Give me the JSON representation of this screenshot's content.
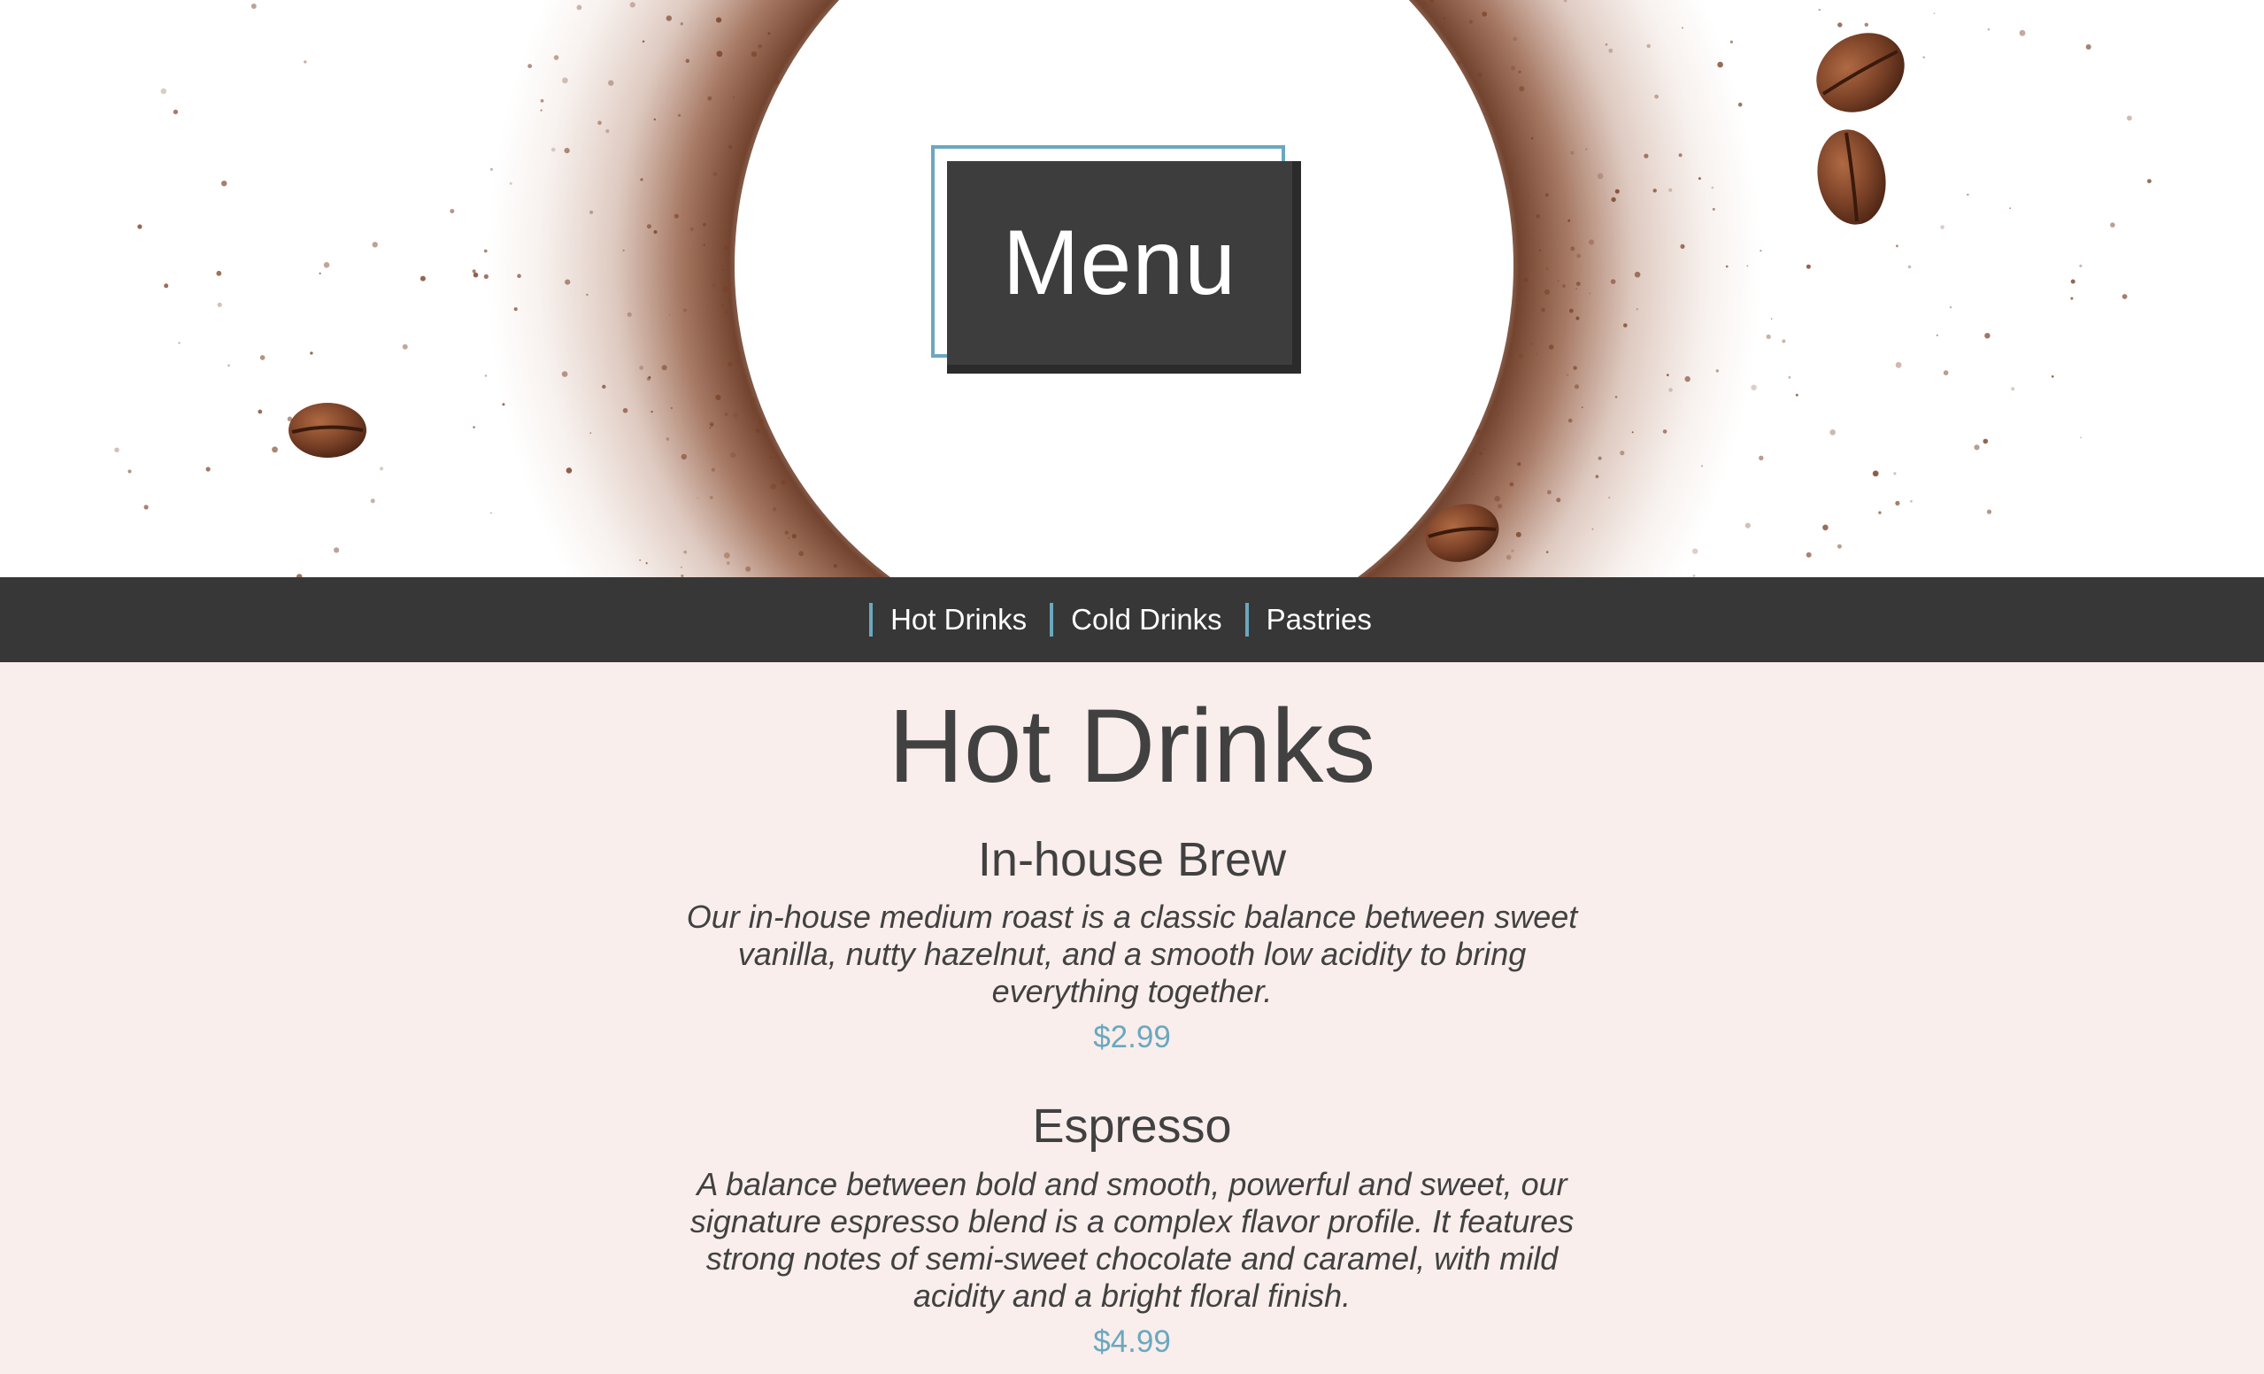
{
  "hero": {
    "title": "Menu"
  },
  "nav": {
    "items": [
      {
        "label": "Hot Drinks"
      },
      {
        "label": "Cold Drinks"
      },
      {
        "label": "Pastries"
      }
    ]
  },
  "section": {
    "title": "Hot Drinks",
    "items": [
      {
        "name": "In-house Brew",
        "description": "Our in-house medium roast is a classic balance between sweet vanilla, nutty hazelnut, and a smooth low acidity to bring everything together.",
        "price": "$2.99"
      },
      {
        "name": "Espresso",
        "description": "A balance between bold and smooth, powerful and sweet, our signature espresso blend is a complex flavor profile. It features strong notes of semi-sweet chocolate and caramel, with mild acidity and a bright floral finish.",
        "price": "$4.99"
      }
    ]
  },
  "colors": {
    "accent": "#6aa8bf",
    "nav_background": "#373737",
    "page_background": "#f9eeec",
    "text": "#414141",
    "coffee": "#6b3a24"
  },
  "hero_image": {
    "icon": "coffee-grounds-circle-image"
  }
}
